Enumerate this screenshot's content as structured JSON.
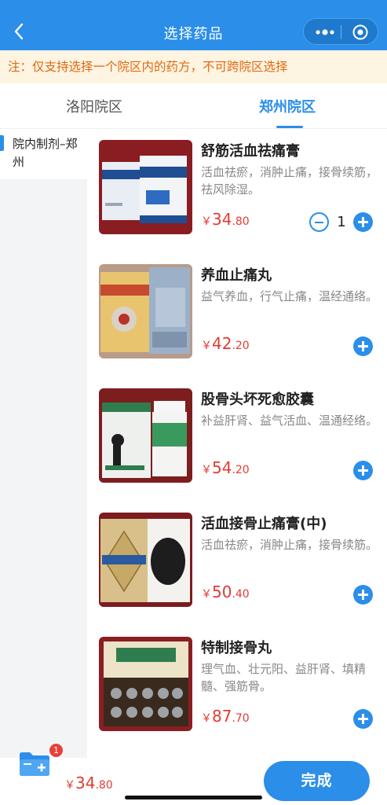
{
  "header": {
    "title": "选择药品",
    "back_icon": "chevron-left-icon",
    "more_icon": "more-dots-icon",
    "close_icon": "target-circle-icon",
    "color": "#2b8ee9"
  },
  "notice": {
    "text": "注：仅支持选择一个院区内的药方，不可跨院区选择",
    "color": "#e2680f",
    "background": "#fdf4e2"
  },
  "tabs": [
    {
      "label": "洛阳院区",
      "active": false
    },
    {
      "label": "郑州院区",
      "active": true
    }
  ],
  "sidebar": {
    "items": [
      {
        "label": "院内制剂–郑州",
        "active": true
      }
    ]
  },
  "products": [
    {
      "name": "舒筋活血祛痛膏",
      "desc": "活血祛瘀，消肿止痛，接骨续筋，祛风除湿。",
      "currency": "￥",
      "price_int": "34",
      "price_dec": ".80",
      "qty": "1"
    },
    {
      "name": "养血止痛丸",
      "desc": "益气养血，行气止痛，温经通络。",
      "currency": "￥",
      "price_int": "42",
      "price_dec": ".20"
    },
    {
      "name": "股骨头坏死愈胶囊",
      "desc": "补益肝肾、益气活血、温通经络。",
      "currency": "￥",
      "price_int": "54",
      "price_dec": ".20"
    },
    {
      "name": "活血接骨止痛膏(中)",
      "desc": "活血祛瘀，消肿止痛，接骨续筋。",
      "currency": "￥",
      "price_int": "50",
      "price_dec": ".40"
    },
    {
      "name": "特制接骨丸",
      "desc": "理气血、壮元阳、益肝肾、填精髓、强筋骨。",
      "currency": "￥",
      "price_int": "87",
      "price_dec": ".70"
    }
  ],
  "footer": {
    "cart_icon": "cart-folder-icon",
    "cart_badge": "1",
    "currency": "￥",
    "total_int": "34",
    "total_dec": ".80",
    "done_label": "完成",
    "accent": "#2b8ee9",
    "price_color": "#e23b34"
  }
}
